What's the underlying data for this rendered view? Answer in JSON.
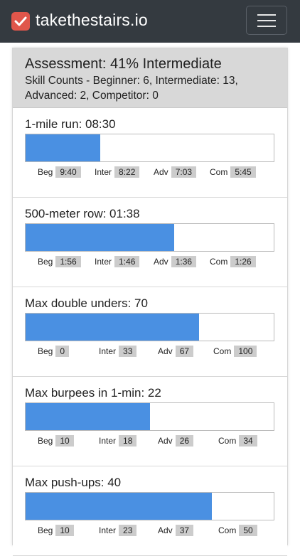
{
  "navbar": {
    "brand": "takethestairs.io",
    "logo_icon": "check-square-icon",
    "menu_icon": "hamburger-icon",
    "colors": {
      "background": "#343a40",
      "logo": "#e0564b"
    }
  },
  "assessment": {
    "title": "Assessment: 41% Intermediate",
    "skill_counts": "Skill Counts - Beginner: 6, Intermediate: 13, Advanced: 2, Competitor: 0"
  },
  "level_labels": {
    "beg": "Beg",
    "inter": "Inter",
    "adv": "Adv",
    "com": "Com"
  },
  "skills": [
    {
      "label": "1-mile run: 08:30",
      "progress_pct": 30,
      "beg": "9:40",
      "inter": "8:22",
      "adv": "7:03",
      "com": "5:45"
    },
    {
      "label": "500-meter row: 01:38",
      "progress_pct": 60,
      "beg": "1:56",
      "inter": "1:46",
      "adv": "1:36",
      "com": "1:26"
    },
    {
      "label": "Max double unders: 70",
      "progress_pct": 70,
      "beg": "0",
      "inter": "33",
      "adv": "67",
      "com": "100"
    },
    {
      "label": "Max burpees in 1-min: 22",
      "progress_pct": 50,
      "beg": "10",
      "inter": "18",
      "adv": "26",
      "com": "34"
    },
    {
      "label": "Max push-ups: 40",
      "progress_pct": 75,
      "beg": "10",
      "inter": "23",
      "adv": "37",
      "com": "50"
    }
  ],
  "colors": {
    "progress_fill": "#4a90e2",
    "level_box": "#cccccc"
  }
}
